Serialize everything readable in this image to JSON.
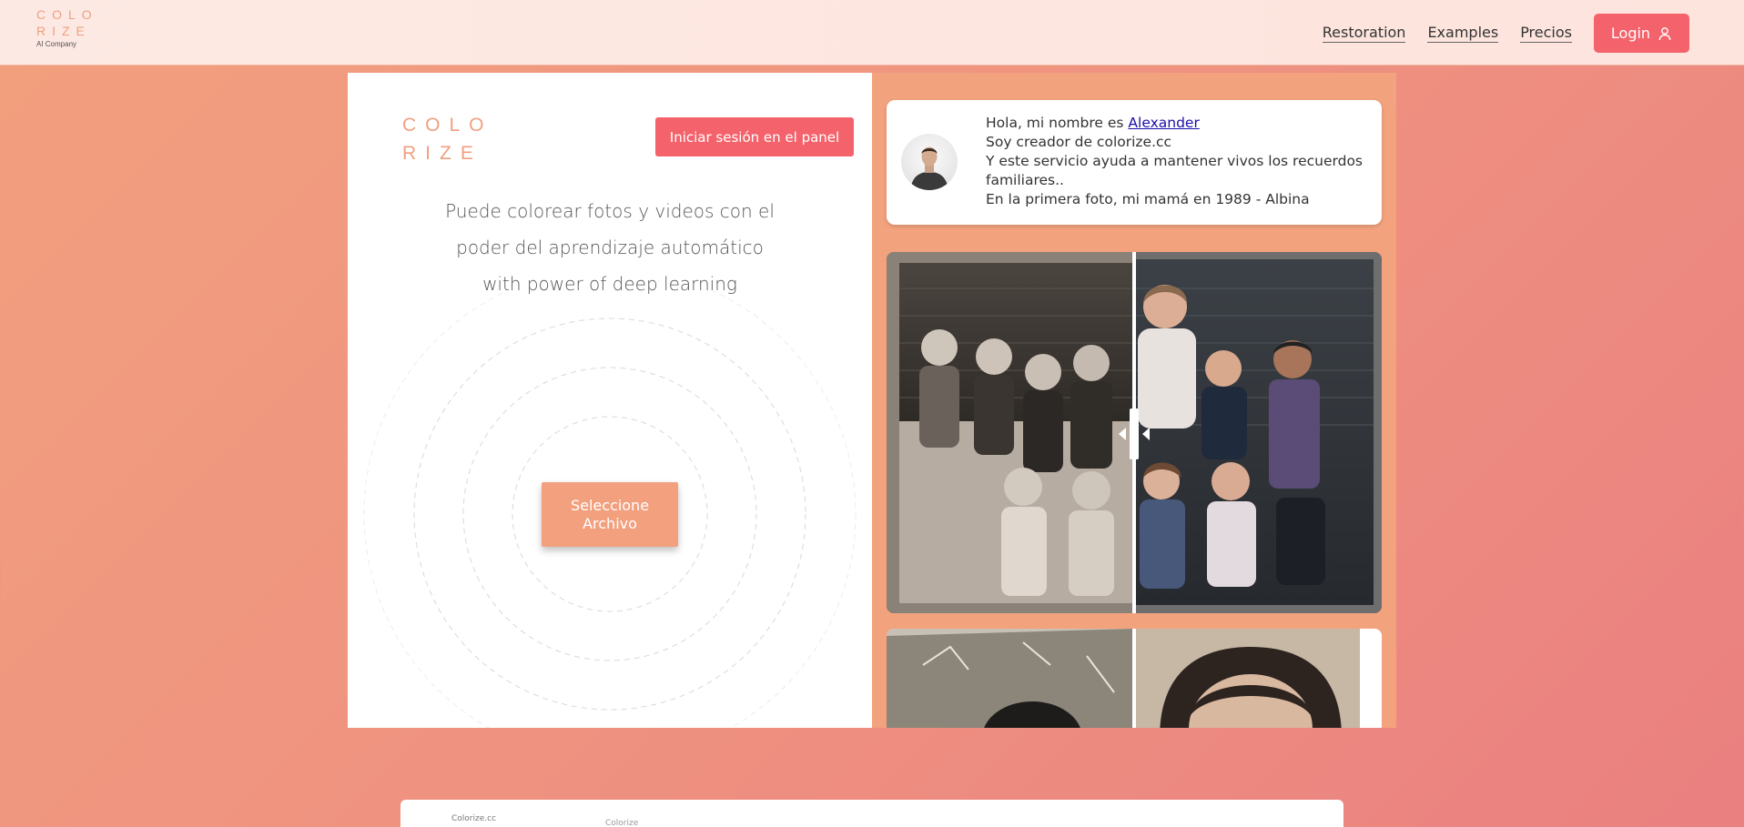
{
  "header": {
    "logo_line1": "COLO",
    "logo_line2": "RIZE",
    "logo_sub": "AI Company",
    "nav": [
      "Restoration",
      "Examples",
      "Precios"
    ],
    "login_label": "Login"
  },
  "left": {
    "logo_line1": "COLO",
    "logo_line2": "RIZE",
    "panel_login_label": "Iniciar sesión en el panel",
    "tagline": [
      "Puede colorear fotos y videos con el",
      "poder del aprendizaje automático",
      "with power of deep learning"
    ],
    "select_label_line1": "Seleccione",
    "select_label_line2": "Archivo"
  },
  "intro": {
    "greeting_prefix": "Hola, mi nombre es ",
    "name_link": "Alexander",
    "line2": "Soy creador de colorize.cc",
    "line3": "Y este servicio ayuda a mantener vivos los recuerdos familiares..",
    "line4": "En la primera foto, mi mamá en 1989 -  Albina"
  },
  "bottom_preview": {
    "site_label": "Colorize.cc",
    "menu_label": "Colorize"
  },
  "colors": {
    "accent": "#f4636b",
    "brand": "#f0a07f",
    "background": "#ef9280"
  }
}
